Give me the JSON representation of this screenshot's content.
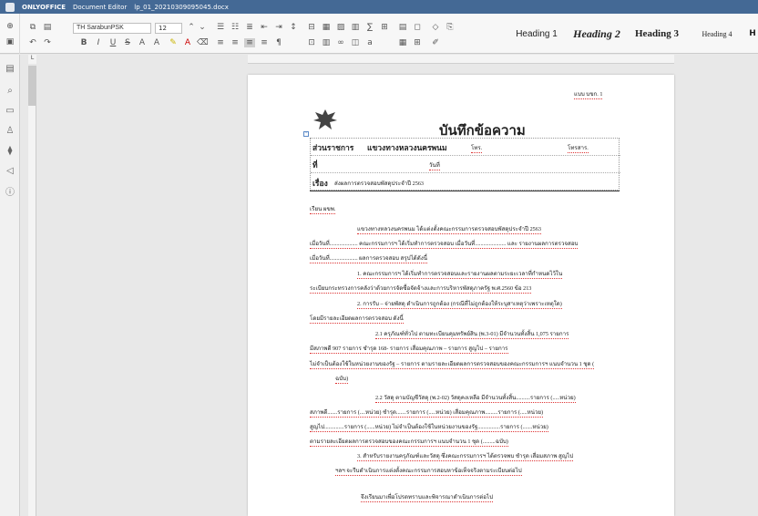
{
  "titlebar": {
    "app": "ONLYOFFICE",
    "editor": "Document Editor",
    "filename": "lp_01_20210309095045.docx"
  },
  "toolbar": {
    "font_name": "TH SarabunPSK",
    "font_size": "12",
    "styles": [
      "Heading 1",
      "Heading 2",
      "Heading 3",
      "Heading 4",
      "H"
    ]
  },
  "document": {
    "top_ref": "แบบ บขก. 1",
    "memo_title": "บันทึกข้อความ",
    "agency_label": "ส่วนราชการ",
    "agency_value": "แขวงทางหลวงนครพนม",
    "phone_label": "โทร.",
    "fax_label": "โทรสาร.",
    "no_label": "ที่",
    "date_label": "วันที่",
    "subject_label": "เรื่อง",
    "subject_value": "ส่งผลการตรวจสอบพัสดุประจำปี 2563",
    "salutation": "เรียน   ผขพ.",
    "lines": [
      "แขวงทางหลวงนครพนม ได้แต่งตั้งคณะกรรมการตรวจสอบพัสดุประจำปี 2563",
      "เมื่อวันที่.................... คณะกรรมการฯ ได้เริ่มทำการตรวจสอบ เมื่อวันที่...................... และ รายงานผลการตรวจสอบ",
      "เมื่อวันที่.................... ผลการตรวจสอบ สรุปได้ดังนี้",
      "1. คณะกรรมการฯ ได้เริ่มทำการตรวจสอบและรายงานผลตามระยะเวลาที่กำหนดไว้ใน",
      "ระเบียบกระทรวงการคลังว่าด้วยการจัดซื้อจัดจ้างและการบริหารพัสดุภาครัฐ พ.ศ.2560 ข้อ 213",
      "2. การรับ – จ่ายพัสดุ ดำเนินการถูกต้อง (กรณีที่ไม่ถูกต้องให้ระบุสาเหตุว่าเพราะเหตุใด)",
      "โดยมีรายละเอียดผลการตรวจสอบ ดังนี้",
      "2.1 ครุภัณฑ์ทั่วไป ตามทะเบียนคุมทรัพย์สิน (พ.3-01) มีจำนวนทั้งสิ้น 1,075 รายการ",
      "มีสภาพดี 907 รายการ ชำรุด 168- รายการ เสื่อมคุณภาพ – รายการ สูญไป – รายการ",
      "ไม่จำเป็นต้องใช้ในหน่วยงานของรัฐ – รายการ ตามรายละเอียดผลการตรวจสอบของคณะกรรมการฯ แนบจำนวน 1 ชุด (",
      "ฉบับ)",
      "2.2 วัสดุ ตามบัญชีวัสดุ (พ.2-02) วัสดุคงเหลือ มีจำนวนทั้งสิ้น..........รายการ (.....หน่วย)",
      "สภาพดี.......รายการ (....หน่วย) ชำรุด.......รายการ (.....หน่วย) เสื่อมคุณภาพ.........รายการ (.....หน่วย)",
      "สูญไป..............รายการ (......หน่วย) ไม่จำเป็นต้องใช้ในหน่วยงานของรัฐ................รายการ (.......หน่วย)",
      "ตามรายละเอียดผลการตรวจสอบของคณะกรรมการฯ แนบจำนวน 1 ชุด (.........ฉบับ)",
      "3. สำหรับรายงานครุภัณฑ์และวัสดุ ซึ่งคณะกรรมการฯ ได้ตรวจพบ ชำรุด เสื่อมสภาพ สูญไป",
      "ฯลฯ จะรีบดำเนินการแต่งตั้งคณะกรรมการสอบหาข้อเท็จจริงตามระเบียบต่อไป",
      "จึงเรียนมาเพื่อโปรดทราบและพิจารณาดำเนินการต่อไป"
    ]
  }
}
